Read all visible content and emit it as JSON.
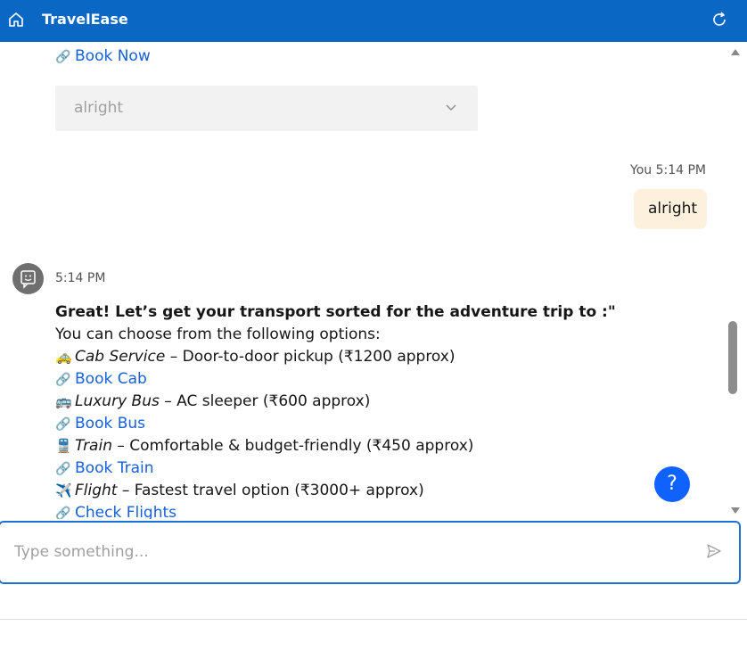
{
  "header": {
    "title": "TravelEase",
    "home_icon": "home-icon",
    "refresh_icon": "refresh-icon",
    "bg_color": "#0a68c4"
  },
  "previous_message": {
    "link_label": "Book Now",
    "dropdown_value": "alright"
  },
  "user_message": {
    "meta": "You 5:14 PM",
    "text": "alright"
  },
  "bot_message": {
    "time": "5:14 PM",
    "heading": "Great! Let’s get your transport sorted for the adventure trip to :\"",
    "intro": "You can choose from the following options:",
    "options": [
      {
        "emoji": "🚕",
        "name": "Cab Service",
        "desc": " – Door-to-door pickup (₹1200 approx)",
        "link": "Book Cab"
      },
      {
        "emoji": "🚌",
        "name": "Luxury Bus",
        "desc": " – AC sleeper (₹600 approx)",
        "link": "Book Bus"
      },
      {
        "emoji": "🚆",
        "name": "Train",
        "desc": " – Comfortable & budget-friendly (₹450 approx)",
        "link": "Book Train"
      },
      {
        "emoji": "✈️",
        "name": "Flight",
        "desc": " – Fastest travel option (₹3000+ approx)",
        "link": "Check Flights"
      }
    ]
  },
  "help_button": {
    "label": "?"
  },
  "composer": {
    "placeholder": "Type something..."
  },
  "colors": {
    "link": "#1660d8",
    "user_bubble": "#fdf1dd",
    "accent": "#0f62fe"
  }
}
